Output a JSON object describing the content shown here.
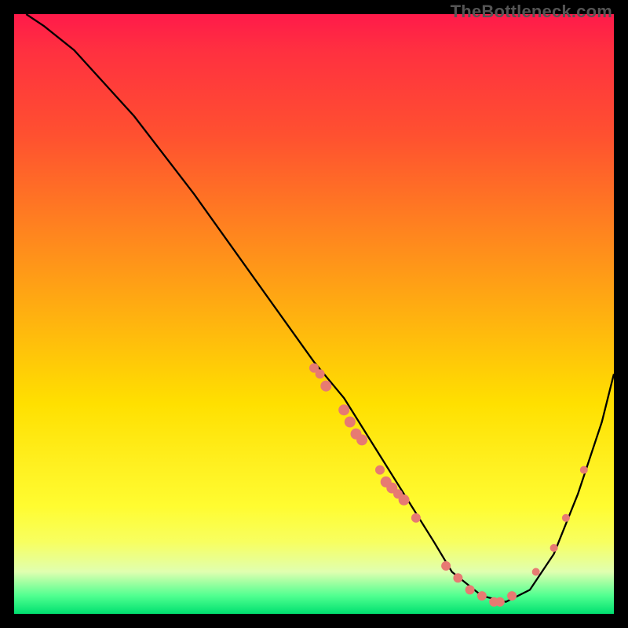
{
  "watermark": "TheBottleneck.com",
  "chart_data": {
    "type": "line",
    "title": "",
    "xlabel": "",
    "ylabel": "",
    "xlim": [
      0,
      100
    ],
    "ylim": [
      0,
      100
    ],
    "curve": {
      "name": "bottleneck-curve",
      "x": [
        2,
        5,
        10,
        20,
        30,
        40,
        50,
        55,
        60,
        65,
        70,
        73,
        78,
        82,
        86,
        90,
        94,
        98,
        100
      ],
      "y": [
        100,
        98,
        94,
        83,
        70,
        56,
        42,
        36,
        28,
        20,
        12,
        7,
        3,
        2,
        4,
        10,
        20,
        32,
        40
      ]
    },
    "markers": {
      "name": "scatter-points",
      "color": "#e77a72",
      "points": [
        {
          "x": 50,
          "y": 41,
          "r": 6
        },
        {
          "x": 51,
          "y": 40,
          "r": 6
        },
        {
          "x": 52,
          "y": 38,
          "r": 7
        },
        {
          "x": 55,
          "y": 34,
          "r": 7
        },
        {
          "x": 56,
          "y": 32,
          "r": 7
        },
        {
          "x": 57,
          "y": 30,
          "r": 7
        },
        {
          "x": 58,
          "y": 29,
          "r": 7
        },
        {
          "x": 61,
          "y": 24,
          "r": 6
        },
        {
          "x": 62,
          "y": 22,
          "r": 7
        },
        {
          "x": 63,
          "y": 21,
          "r": 7
        },
        {
          "x": 64,
          "y": 20,
          "r": 6
        },
        {
          "x": 65,
          "y": 19,
          "r": 7
        },
        {
          "x": 67,
          "y": 16,
          "r": 6
        },
        {
          "x": 72,
          "y": 8,
          "r": 6
        },
        {
          "x": 74,
          "y": 6,
          "r": 6
        },
        {
          "x": 76,
          "y": 4,
          "r": 6
        },
        {
          "x": 78,
          "y": 3,
          "r": 6
        },
        {
          "x": 80,
          "y": 2,
          "r": 6
        },
        {
          "x": 81,
          "y": 2,
          "r": 6
        },
        {
          "x": 83,
          "y": 3,
          "r": 6
        },
        {
          "x": 87,
          "y": 7,
          "r": 5
        },
        {
          "x": 90,
          "y": 11,
          "r": 5
        },
        {
          "x": 92,
          "y": 16,
          "r": 5
        },
        {
          "x": 95,
          "y": 24,
          "r": 5
        }
      ]
    }
  }
}
